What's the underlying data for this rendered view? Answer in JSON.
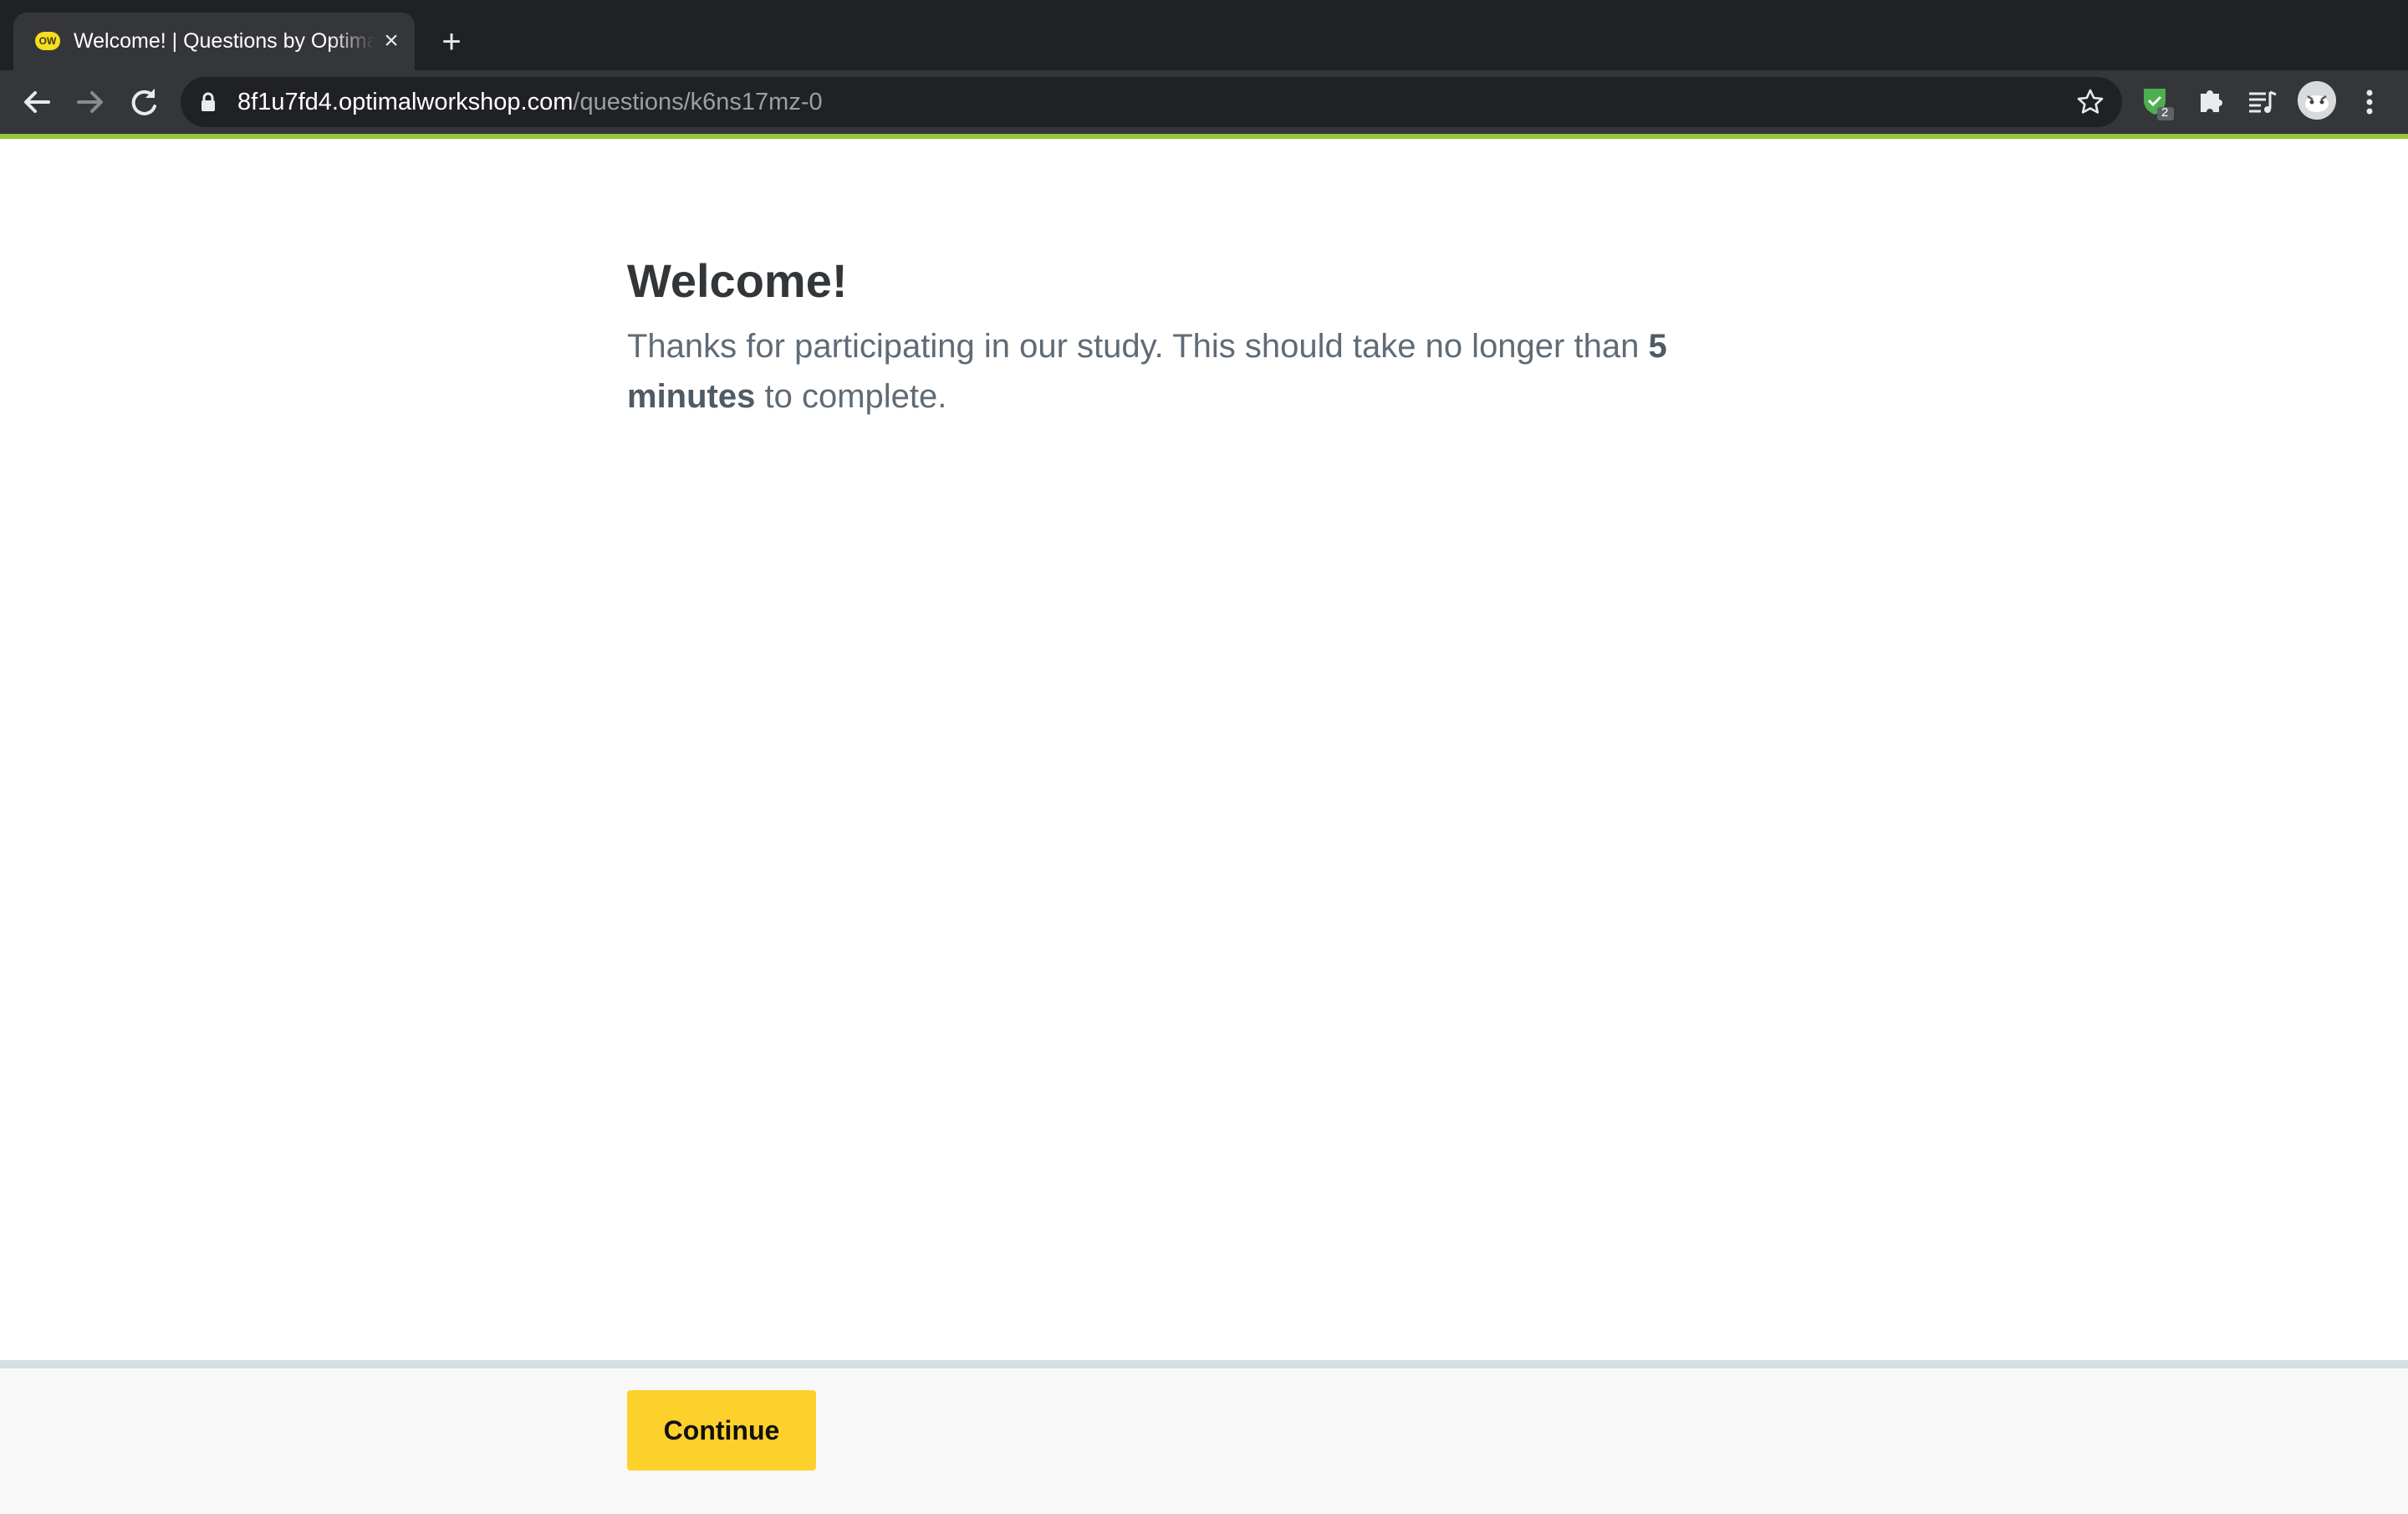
{
  "browser": {
    "tab": {
      "favicon_text": "OW",
      "title": "Welcome! | Questions by Optimal Workshop"
    },
    "url": {
      "host": "8f1u7fd4.optimalworkshop.com",
      "path": "/questions/k6ns17mz-0"
    },
    "extension_badge": "2",
    "icons": {
      "back": "back-arrow-icon",
      "forward": "forward-arrow-icon",
      "reload": "reload-icon",
      "lock": "lock-icon",
      "bookmark": "star-icon",
      "extension_shield": "shield-check-icon",
      "extensions": "puzzle-icon",
      "media": "media-queue-icon",
      "menu": "more-vert-icon"
    },
    "accent_color": "#97c43b"
  },
  "page": {
    "heading": "Welcome!",
    "intro_prefix": "Thanks for participating in our study. This should take no longer than ",
    "intro_bold": "5 minutes",
    "intro_suffix": " to complete."
  },
  "footer": {
    "continue_label": "Continue",
    "button_color": "#fdd12b"
  }
}
